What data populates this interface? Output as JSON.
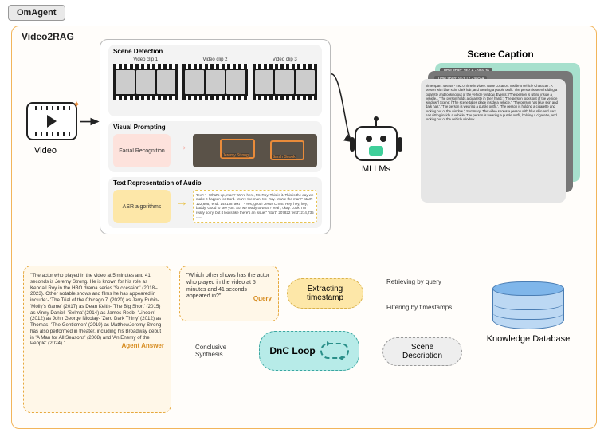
{
  "tag": "OmAgent",
  "outer_title": "Video2RAG",
  "video_label": "Video",
  "mllm_label": "MLLMs",
  "scene_caption_title": "Scene Caption",
  "kdb_label": "Knowledge Database",
  "scene_detection": {
    "title": "Scene Detection",
    "clips": [
      "Video clip 1",
      "Video clip 2",
      "Video clip 3"
    ]
  },
  "visual_prompting": {
    "title": "Visual Prompting",
    "module": "Facial Recognition",
    "faces": [
      "Jeremy Strong",
      "Sarah Snook"
    ]
  },
  "text_audio": {
    "title": "Text Representation of Audio",
    "module": "ASR algorithms",
    "asr_text": "'text': \"- What's up, man? We're here, Mr. Roy. This is it. This is the day we make it happen for Cord. You're the man, Mr. Roy. You're the man!\"  'start': 122,605, 'end': 148138\n'text': \"- Yes, good! Jesus Christ. Hey, hey, hey, buddy. Good to see you. So, we ready to what? Yeah, okay. Look, I'm really sorry, but it looks like there's an issue.\" 'start': 207822 'end': 214,735\n......"
  },
  "scene_card": {
    "ts_back": "Time span: 962.4 - 966.36",
    "ts_mid": "Time span: 963.12 - 965.4",
    "front": "Time span: 486.48 - 492.0\nTime in video: None\nLocation: Inside a vehicle\nCharacter: A person with blue skin, dark hair, and wearing a purple outfit. The person is seen holding a cigarette and looking out of the vehicle window.\nEvents: ['The person is sitting inside a vehicle.', 'The person holds a cigarette in their hand.', 'The person looks out of the vehicle window.']\nScene: ['The scene takes place inside a vehicle.', 'The person has blue skin and dark hair.', 'The person is wearing a purple outfit.', 'The person is holding a cigarette and looking out of the window.']\nSummary: The video shows a person with blue skin and dark hair sitting inside a vehicle. The person is wearing a purple outfit, holding a cigarette, and looking out of the vehicle window."
  },
  "nodes": {
    "extract": "Extracting timestamp",
    "scene_desc": "Scene Description",
    "dnc": "DnC Loop"
  },
  "arrows": {
    "retrieving": "Retrieving by query",
    "filtering": "Filtering by timestamps",
    "conclusive": "Conclusive Synthesis"
  },
  "query": {
    "text": "\"Which other shows has the actor who played in the video at 5 minutes and 41 seconds appeared in?\"",
    "tag": "Query"
  },
  "answer": {
    "text": "\"The actor who played in the video at 5 minutes and 41 seconds is Jeremy Strong. He is known for his role as Kendall Roy in the HBO drama series 'Succession' (2018–2023). Other notable shows and films he has appeared in include:- 'The Trial of the Chicago 7' (2020) as Jerry Rubin- 'Molly's Game' (2017) as Dean Keith- 'The Big Short' (2015) as Vinny Daniel- 'Selma' (2014) as James Reeb- 'Lincoln' (2012) as John George Nicolay- 'Zero Dark Thirty' (2012) as Thomas- 'The Gentlemen' (2019) as MatthewJeremy Strong has also performed in theater, including his Broadway debut in 'A Man for All Seasons' (2008) and 'An Enemy of the People' (2024).\"",
    "tag": "Agent Answer"
  }
}
